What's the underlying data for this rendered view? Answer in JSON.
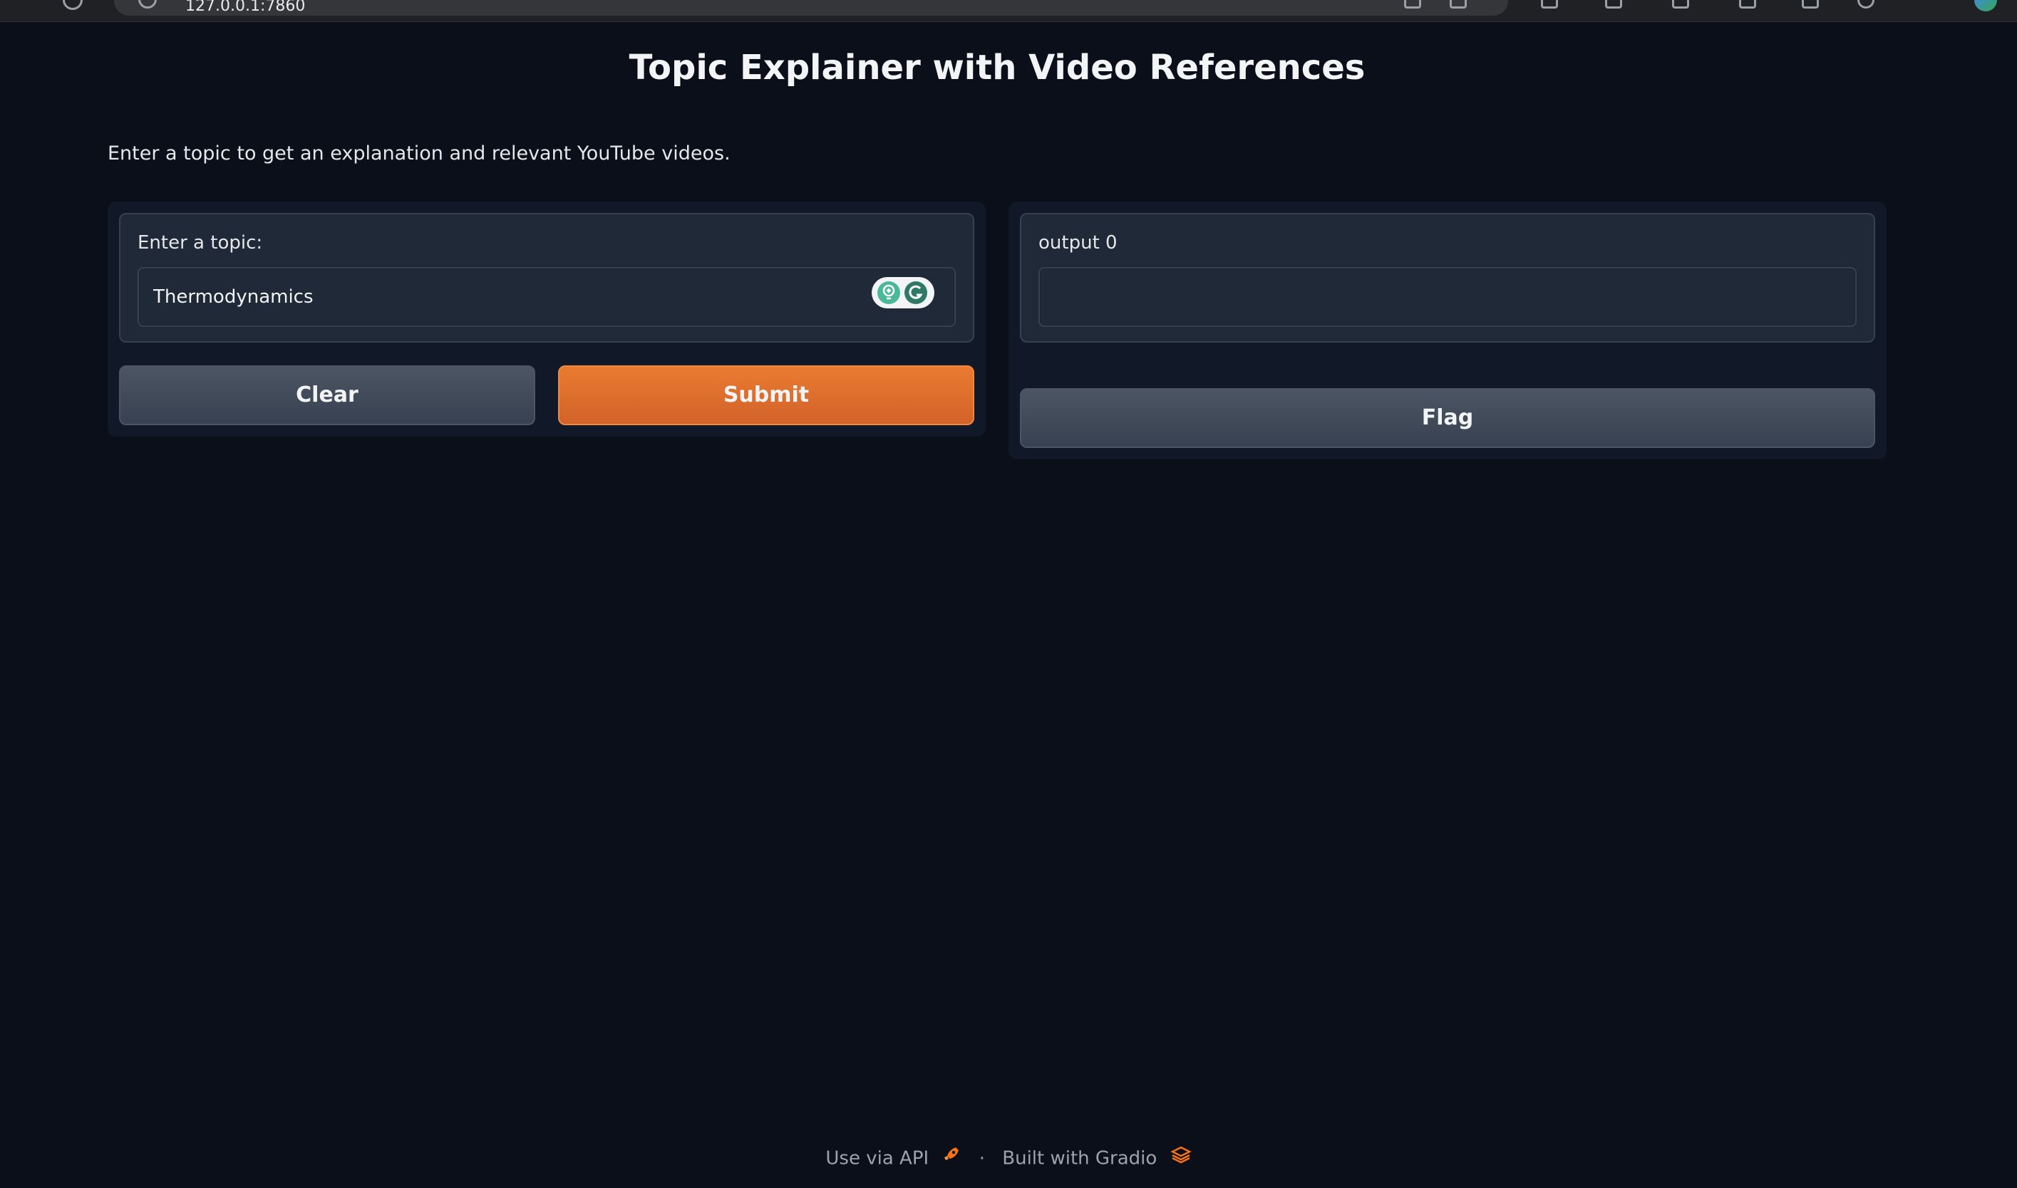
{
  "browser": {
    "url_text": "127.0.0.1:7860",
    "profile_icon": "profile-avatar-icon"
  },
  "app": {
    "title": "Topic Explainer with Video References",
    "description": "Enter a topic to get an explanation and relevant YouTube videos."
  },
  "input": {
    "label": "Enter a topic:",
    "value": "Thermodynamics",
    "extension_icon": "grammarly-icon"
  },
  "output": {
    "label": "output 0",
    "value": ""
  },
  "buttons": {
    "clear_label": "Clear",
    "submit_label": "Submit",
    "flag_label": "Flag"
  },
  "footer": {
    "api_label": "Use via API",
    "separator": "·",
    "built_with": "Built with Gradio",
    "api_icon": "rocket-icon",
    "gradio_icon": "gradio-logo-icon"
  },
  "colors": {
    "background": "#0b0f19",
    "panel": "#111827",
    "block": "#1f2937",
    "accent": "#e8702c",
    "secondary_button": "#4b5563"
  }
}
